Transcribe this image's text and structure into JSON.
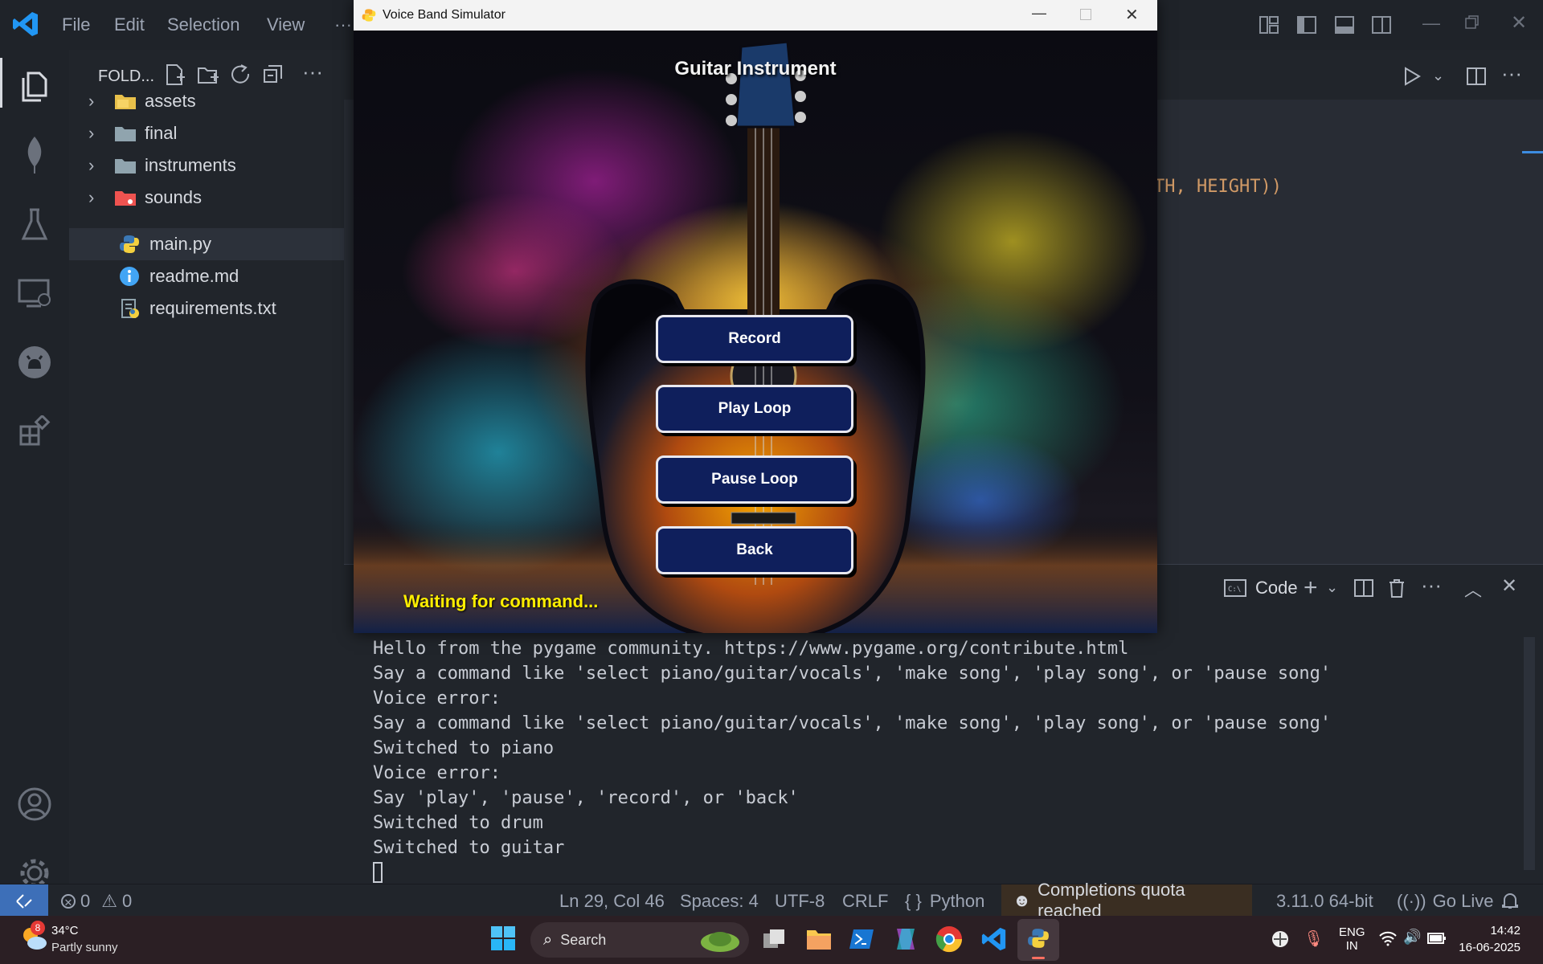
{
  "menu": [
    "File",
    "Edit",
    "Selection",
    "View"
  ],
  "menu_more": "···",
  "explorer": {
    "title": "FOLD...",
    "items": [
      {
        "label": "assets",
        "type": "folder",
        "color": "#e8c04a"
      },
      {
        "label": "final",
        "type": "folder",
        "color": "#90a4ae"
      },
      {
        "label": "instruments",
        "type": "folder",
        "color": "#90a4ae"
      },
      {
        "label": "sounds",
        "type": "folder",
        "color": "#ef5350"
      },
      {
        "label": "main.py",
        "type": "python"
      },
      {
        "label": "readme.md",
        "type": "info"
      },
      {
        "label": "requirements.txt",
        "type": "txt"
      }
    ]
  },
  "editor": {
    "code_fragment": "TH, HEIGHT))"
  },
  "panel": {
    "shell_label": "Code",
    "terminal_lines": [
      "Hello from the pygame community. https://www.pygame.org/contribute.html",
      "Say a command like 'select piano/guitar/vocals', 'make song', 'play song', or 'pause song'",
      "Voice error:",
      "Say a command like 'select piano/guitar/vocals', 'make song', 'play song', or 'pause song'",
      "Switched to piano",
      "Voice error:",
      "Say 'play', 'pause', 'record', or 'back'",
      "Switched to drum",
      "Switched to guitar"
    ]
  },
  "pygame": {
    "window_title": "Voice Band Simulator",
    "heading": "Guitar Instrument",
    "buttons": [
      "Record",
      "Play Loop",
      "Pause Loop",
      "Back"
    ],
    "status": "Waiting for command..."
  },
  "status_bar": {
    "errors": "0",
    "warnings": "0",
    "position": "Ln 29, Col 46",
    "spaces": "Spaces: 4",
    "encoding": "UTF-8",
    "eol": "CRLF",
    "language": "Python",
    "language_icon": "{ }",
    "copilot": "Completions quota reached",
    "interpreter": "3.11.0 64-bit",
    "golive": "Go Live"
  },
  "taskbar": {
    "weather_temp": "34°C",
    "weather_desc": "Partly sunny",
    "weather_badge": "8",
    "search": "Search",
    "lang": "ENG",
    "region": "IN",
    "time": "14:42",
    "date": "16-06-2025"
  },
  "colors": {
    "accent": "#0a5bd3",
    "pygame_button": "#0f1f5c",
    "status_text": "#ffee00"
  }
}
